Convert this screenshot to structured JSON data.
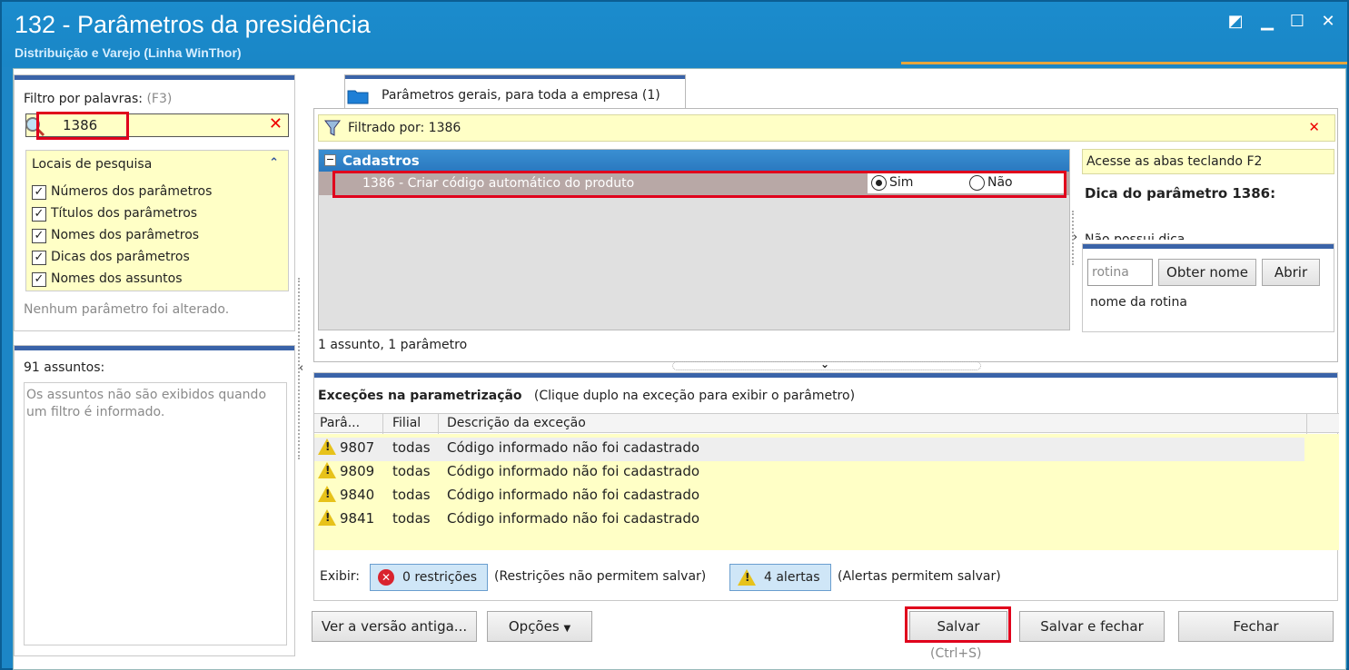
{
  "window": {
    "title": "132 - Parâmetros da presidência",
    "subtitle": "Distribuição e Varejo (Linha WinThor)"
  },
  "filter": {
    "label": "Filtro por palavras:",
    "shortcut": "(F3)",
    "value": "1386",
    "search_locations_title": "Locais de pesquisa",
    "options": [
      {
        "label": "Números dos parâmetros",
        "checked": true
      },
      {
        "label": "Títulos dos parâmetros",
        "checked": true
      },
      {
        "label": "Nomes dos parâmetros",
        "checked": true
      },
      {
        "label": "Dicas dos parâmetros",
        "checked": true
      },
      {
        "label": "Nomes dos assuntos",
        "checked": true
      }
    ],
    "status": "Nenhum parâmetro foi alterado."
  },
  "subjects": {
    "count_label": "91 assuntos:",
    "note": "Os assuntos não são exibidos quando um filtro é informado."
  },
  "tab": {
    "label": "Parâmetros gerais, para toda a empresa  (1)"
  },
  "filtered": {
    "label": "Filtrado por: 1386"
  },
  "group": {
    "title": "Cadastros",
    "param": "1386 - Criar código automático do produto",
    "opt_yes": "Sim",
    "opt_no": "Não"
  },
  "summary": "1 assunto, 1 parâmetro",
  "hint": {
    "access": "Acesse as abas teclando F2",
    "title": "Dica do parâmetro 1386:",
    "text": "Não possui dica."
  },
  "routine": {
    "placeholder": "rotina",
    "get_name": "Obter nome",
    "open": "Abrir",
    "name_label": "nome da rotina"
  },
  "exceptions": {
    "title": "Exceções na parametrização",
    "hint": "(Clique duplo na exceção para exibir o parâmetro)",
    "columns": [
      "Parâ...",
      "Filial",
      "Descrição da exceção"
    ],
    "rows": [
      {
        "param": "9807",
        "branch": "todas",
        "desc": "Código informado não foi cadastrado"
      },
      {
        "param": "9809",
        "branch": "todas",
        "desc": "Código informado não foi cadastrado"
      },
      {
        "param": "9840",
        "branch": "todas",
        "desc": "Código informado não foi cadastrado"
      },
      {
        "param": "9841",
        "branch": "todas",
        "desc": "Código informado não foi cadastrado"
      }
    ],
    "show_label": "Exibir:",
    "restrictions": "0 restrições",
    "restrictions_note": "(Restrições não permitem salvar)",
    "alerts": "4 alertas",
    "alerts_note": "(Alertas permitem salvar)"
  },
  "footer": {
    "old_version": "Ver a versão antiga...",
    "options": "Opções",
    "save": "Salvar",
    "save_shortcut": "(Ctrl+S)",
    "save_close": "Salvar e fechar",
    "close": "Fechar"
  }
}
